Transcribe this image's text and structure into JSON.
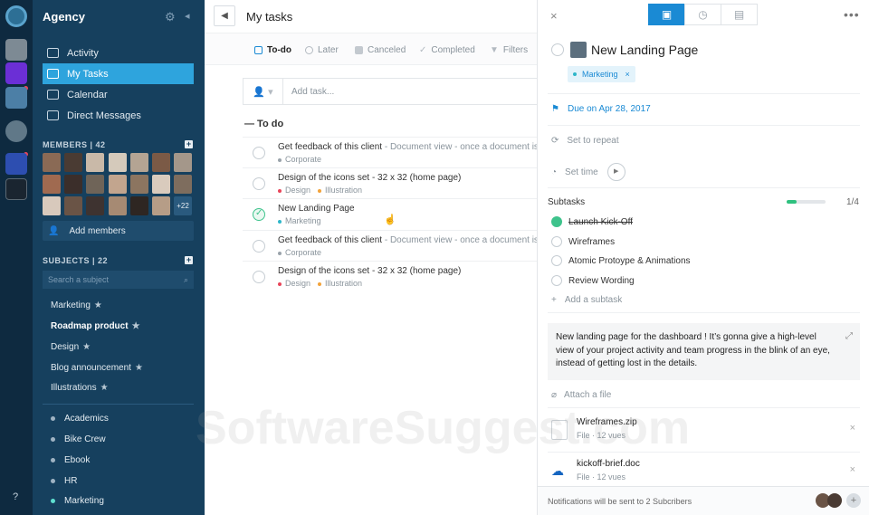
{
  "sidebar": {
    "title": "Agency",
    "nav": [
      {
        "label": "Activity",
        "active": false
      },
      {
        "label": "My Tasks",
        "active": true
      },
      {
        "label": "Calendar",
        "active": false
      },
      {
        "label": "Direct Messages",
        "active": false
      }
    ],
    "members_header": "MEMBERS | 42",
    "members_more": "+22",
    "add_members": "Add members",
    "subjects_header": "SUBJECTS | 22",
    "search_placeholder": "Search a subject",
    "starred": [
      {
        "label": "Marketing",
        "bold": false
      },
      {
        "label": "Roadmap product",
        "bold": true
      },
      {
        "label": "Design",
        "bold": false
      },
      {
        "label": "Blog announcement",
        "bold": false
      },
      {
        "label": "Illustrations",
        "bold": false
      }
    ],
    "tags": [
      {
        "label": "Academics",
        "color": "#9fb3c3"
      },
      {
        "label": "Bike Crew",
        "color": "#9fb3c3"
      },
      {
        "label": "Ebook",
        "color": "#9fb3c3"
      },
      {
        "label": "HR",
        "color": "#9fb3c3"
      },
      {
        "label": "Marketing",
        "color": "#5fe0d0"
      }
    ],
    "help": "?"
  },
  "tasks": {
    "title": "My tasks",
    "filters": [
      {
        "label": "To-do",
        "active": true
      },
      {
        "label": "Later",
        "active": false
      },
      {
        "label": "Canceled",
        "active": false
      },
      {
        "label": "Completed",
        "active": false
      },
      {
        "label": "Filters",
        "active": false
      }
    ],
    "add_task_placeholder": "Add task...",
    "group": "— To do",
    "rows": [
      {
        "name": "Get feedback of this client",
        "desc": " - Document view - once a document is imp",
        "tags": [
          {
            "label": "Corporate",
            "color": "#9aa3ab"
          }
        ],
        "done": false
      },
      {
        "name": "Design of the icons set - 32 x 32 (home page)",
        "desc": "",
        "tags": [
          {
            "label": "Design",
            "color": "#e8455a"
          },
          {
            "label": "Illustration",
            "color": "#f2a33a"
          }
        ],
        "done": false
      },
      {
        "name": "New Landing Page",
        "desc": "",
        "tags": [
          {
            "label": "Marketing",
            "color": "#2eb6c9"
          }
        ],
        "done": true
      },
      {
        "name": "Get feedback of this client",
        "desc": " - Document view - once a document is imp",
        "tags": [
          {
            "label": "Corporate",
            "color": "#9aa3ab"
          }
        ],
        "done": false
      },
      {
        "name": "Design of the icons set - 32 x 32 (home page)",
        "desc": "",
        "tags": [
          {
            "label": "Design",
            "color": "#e8455a"
          },
          {
            "label": "Illustration",
            "color": "#f2a33a"
          }
        ],
        "done": false
      }
    ]
  },
  "detail": {
    "title": "New Landing Page",
    "tag": "Marketing",
    "due": "Due on Apr 28, 2017",
    "repeat": "Set to repeat",
    "time": "Set time",
    "subtasks_label": "Subtasks",
    "subtasks_count": "1/4",
    "subtasks_progress": 0.25,
    "subtasks": [
      {
        "label": "Launch Kick-Off",
        "done": true
      },
      {
        "label": "Wireframes",
        "done": false
      },
      {
        "label": "Atomic Protoype & Animations",
        "done": false
      },
      {
        "label": "Review Wording",
        "done": false
      }
    ],
    "add_subtask": "Add a subtask",
    "description": "New landing page for the dashboard ! It’s gonna give a high-level view of your project activity and team progress in the blink of an eye, instead of getting lost in the details.",
    "attach": "Attach a file",
    "files": [
      {
        "name": "Wireframes.zip",
        "meta": "File · 12 vues"
      },
      {
        "name": "kickoff-brief.doc",
        "meta": "File · 12 vues"
      }
    ],
    "notification": "Notifications will be sent to 2 Subcribers"
  },
  "watermark": "SoftwareSuggest.com",
  "colors": {
    "accent": "#2ea4dd",
    "sidebar": "#16405e",
    "rail": "#0e2a40",
    "success": "#3ec38c"
  }
}
